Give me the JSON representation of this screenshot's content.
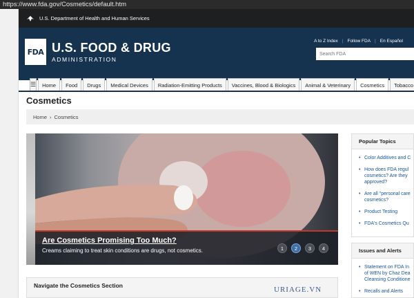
{
  "browser": {
    "url": "https://www.fda.gov/Cosmetics/default.htm"
  },
  "hhs": {
    "text": "U.S. Department of Health and Human Services"
  },
  "header": {
    "logo": "FDA",
    "title": "U.S. FOOD & DRUG",
    "subtitle": "ADMINISTRATION",
    "links": [
      "A to Z Index",
      "Follow FDA",
      "En Español"
    ],
    "search_placeholder": "Search FDA"
  },
  "nav": {
    "menu_icon": "hamburger-icon",
    "items": [
      "Home",
      "Food",
      "Drugs",
      "Medical Devices",
      "Radiation-Emitting Products",
      "Vaccines, Blood & Biologics",
      "Animal & Veterinary",
      "Cosmetics",
      "Tobacco"
    ],
    "active": "Cosmetics"
  },
  "page": {
    "title": "Cosmetics",
    "breadcrumb": [
      "Home",
      "Cosmetics"
    ]
  },
  "hero": {
    "title": "Are Cosmetics Promising Too Much?",
    "subtitle": "Creams claiming to treat skin conditions are drugs, not cosmetics.",
    "slides": [
      "1",
      "2",
      "3",
      "4"
    ],
    "active_slide": "2"
  },
  "navigate_section": {
    "title": "Navigate the Cosmetics Section"
  },
  "watermark": "URIAGE.VN",
  "popular_topics": {
    "title": "Popular Topics",
    "items": [
      "Color Additives and C",
      "How does FDA regul\ncosmetics? Are they\napproved?",
      "Are all \"personal care\ncosmetics?",
      "Product Testing",
      "FDA's Cosmetics Qu"
    ]
  },
  "issues_alerts": {
    "title": "Issues and Alerts",
    "items": [
      "Statement on FDA In\nof WEN by Chaz Dea\nCleansing Conditione",
      "Recalls and Alerts"
    ]
  },
  "colors": {
    "header_blue": "#15324f",
    "link_blue": "#1a55a0",
    "accent_red": "#c0392b"
  }
}
